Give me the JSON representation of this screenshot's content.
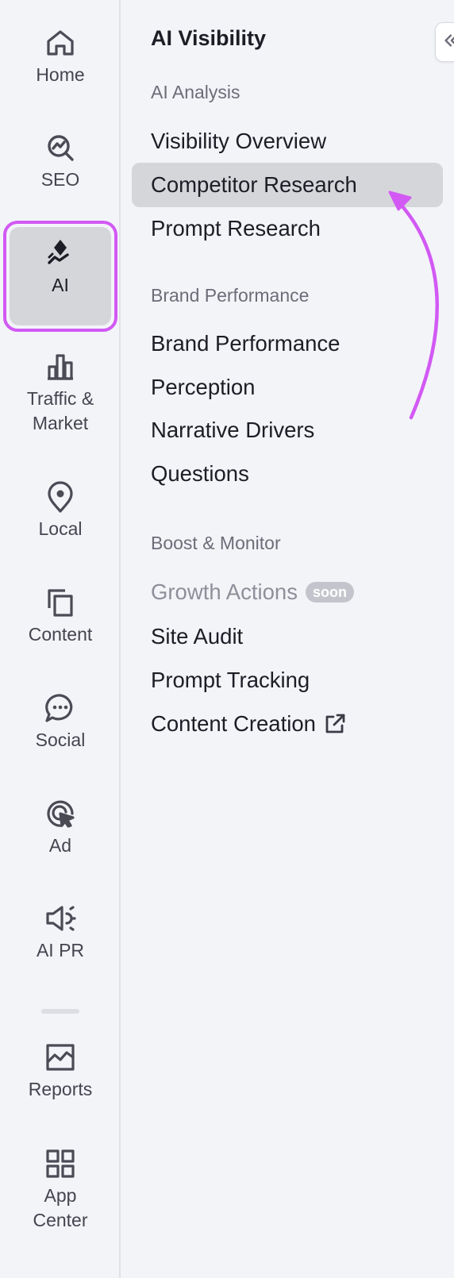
{
  "rail": {
    "items": [
      {
        "label": "Home",
        "icon": "home-icon"
      },
      {
        "label": "SEO",
        "icon": "seo-icon"
      },
      {
        "label": "AI",
        "icon": "ai-icon",
        "active": true
      },
      {
        "label": "Traffic &\nMarket",
        "icon": "traffic-market-icon"
      },
      {
        "label": "Local",
        "icon": "location-pin-icon"
      },
      {
        "label": "Content",
        "icon": "content-icon"
      },
      {
        "label": "Social",
        "icon": "chat-bubble-icon"
      },
      {
        "label": "Ad",
        "icon": "ad-target-icon"
      },
      {
        "label": "AI PR",
        "icon": "megaphone-icon"
      },
      {
        "label": "Reports",
        "icon": "reports-icon"
      },
      {
        "label": "App\nCenter",
        "icon": "app-grid-icon"
      }
    ]
  },
  "panel": {
    "title": "AI Visibility",
    "sections": [
      {
        "heading": "AI Analysis",
        "items": [
          {
            "label": "Visibility Overview"
          },
          {
            "label": "Competitor Research",
            "selected": true
          },
          {
            "label": "Prompt Research"
          }
        ]
      },
      {
        "heading": "Brand Performance",
        "items": [
          {
            "label": "Brand Performance"
          },
          {
            "label": "Perception"
          },
          {
            "label": "Narrative Drivers"
          },
          {
            "label": "Questions"
          }
        ]
      },
      {
        "heading": "Boost & Monitor",
        "items": [
          {
            "label": "Growth Actions",
            "badge": "soon",
            "disabled": true
          },
          {
            "label": "Site Audit"
          },
          {
            "label": "Prompt Tracking"
          },
          {
            "label": "Content Creation",
            "external": true
          }
        ]
      }
    ]
  },
  "colors": {
    "highlight": "#d259f4",
    "selected_bg": "#d5d6da",
    "background": "#f3f4f8"
  }
}
